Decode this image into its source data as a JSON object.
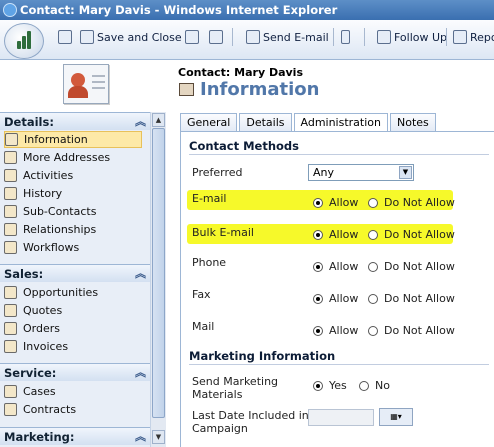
{
  "window": {
    "title": "Contact: Mary Davis - Windows Internet Explorer"
  },
  "toolbar": {
    "save_close": "Save and Close",
    "send_email": "Send E-mail",
    "follow_up": "Follow Up",
    "reports": "Repo"
  },
  "header": {
    "contact_name": "Contact: Mary Davis",
    "page_title": "Information"
  },
  "sidebar": {
    "details_title": "Details:",
    "details_items": [
      "Information",
      "More Addresses",
      "Activities",
      "History",
      "Sub-Contacts",
      "Relationships",
      "Workflows"
    ],
    "sales_title": "Sales:",
    "sales_items": [
      "Opportunities",
      "Quotes",
      "Orders",
      "Invoices"
    ],
    "service_title": "Service:",
    "service_items": [
      "Cases",
      "Contracts"
    ],
    "marketing_title": "Marketing:"
  },
  "tabs": [
    "General",
    "Details",
    "Administration",
    "Notes"
  ],
  "form": {
    "contact_methods_title": "Contact Methods",
    "preferred_label": "Preferred",
    "preferred_value": "Any",
    "rows": [
      {
        "label": "E-mail",
        "allow": "Allow",
        "deny": "Do Not Allow"
      },
      {
        "label": "Bulk E-mail",
        "allow": "Allow",
        "deny": "Do Not Allow"
      },
      {
        "label": "Phone",
        "allow": "Allow",
        "deny": "Do Not Allow"
      },
      {
        "label": "Fax",
        "allow": "Allow",
        "deny": "Do Not Allow"
      },
      {
        "label": "Mail",
        "allow": "Allow",
        "deny": "Do Not Allow"
      }
    ],
    "marketing_title": "Marketing Information",
    "send_marketing_label_1": "Send Marketing",
    "send_marketing_label_2": "Materials",
    "yes": "Yes",
    "no": "No",
    "last_date_label_1": "Last Date Included in",
    "last_date_label_2": "Campaign"
  },
  "colors": {
    "highlight": "#f6f92a",
    "title_blue": "#5177a9",
    "selected_nav": "#fde9a7"
  }
}
